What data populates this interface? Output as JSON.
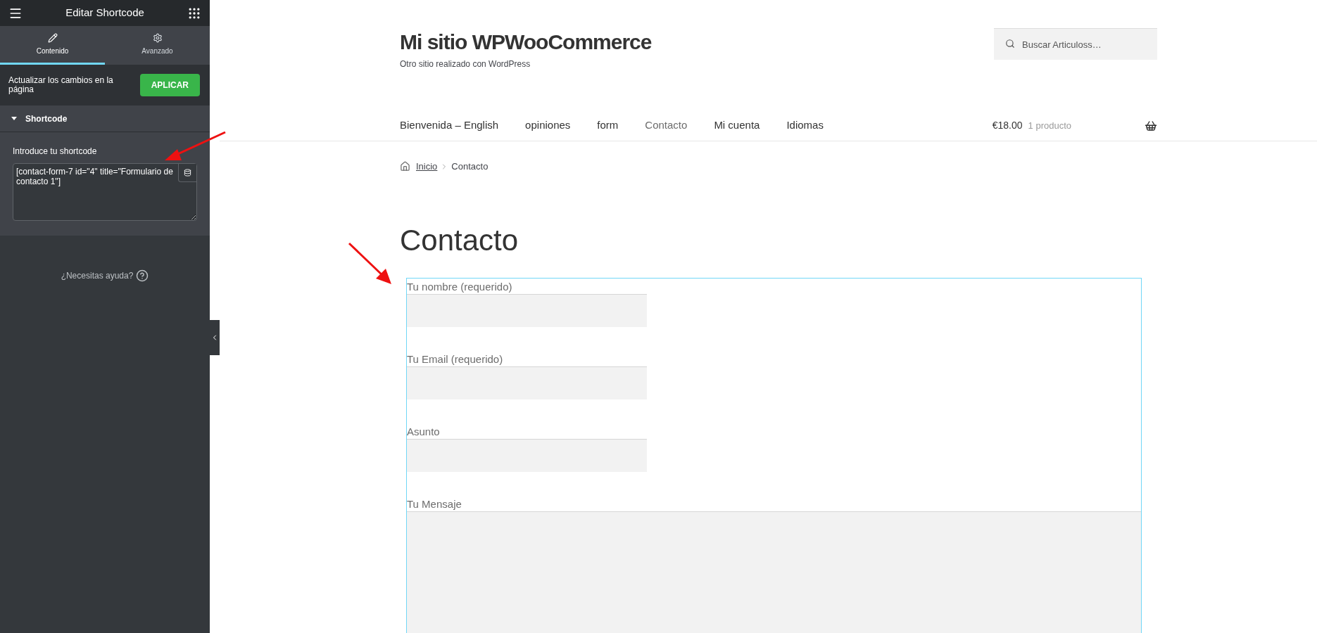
{
  "panel": {
    "title": "Editar Shortcode",
    "tabs": [
      {
        "label": "Contenido",
        "selected": true
      },
      {
        "label": "Avanzado",
        "selected": false
      }
    ],
    "apply": {
      "text": "Actualizar los cambios en la página",
      "button": "APLICAR"
    },
    "section": {
      "title": "Shortcode",
      "expanded": true,
      "field_label": "Introduce tu shortcode",
      "value": "[contact-form-7 id=\"4\" title=\"Formulario de contacto 1\"]"
    },
    "help": "¿Necesitas ayuda?"
  },
  "site": {
    "title": "Mi sitio WPWooCommerce",
    "tagline": "Otro sitio realizado con WordPress",
    "search": {
      "placeholder": "Buscar Articuloss…"
    },
    "nav": [
      {
        "label": "Bienvenida – English",
        "selected": false
      },
      {
        "label": "opiniones",
        "selected": false
      },
      {
        "label": "form",
        "selected": false
      },
      {
        "label": "Contacto",
        "selected": true
      },
      {
        "label": "Mi cuenta",
        "selected": false
      },
      {
        "label": "Idiomas",
        "selected": false
      }
    ],
    "cart": {
      "total": "€18.00",
      "count": "1 producto"
    },
    "breadcrumb": [
      "Inicio",
      "Contacto"
    ],
    "page_title": "Contacto",
    "form": [
      {
        "label": "Tu nombre (requerido)",
        "kind": "input"
      },
      {
        "label": "Tu Email (requerido)",
        "kind": "input"
      },
      {
        "label": "Asunto",
        "kind": "input"
      },
      {
        "label": "Tu Mensaje",
        "kind": "textarea"
      }
    ]
  }
}
